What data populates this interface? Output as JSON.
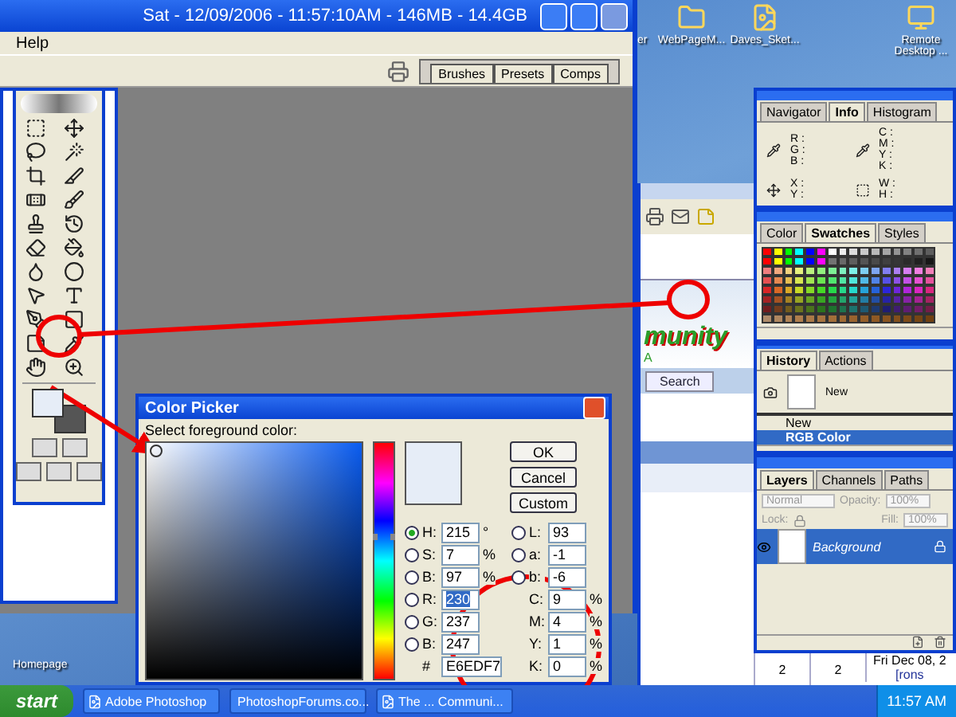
{
  "desktop": {
    "icons": [
      {
        "label": "WebPageM..."
      },
      {
        "label": "Daves_Sket..."
      },
      {
        "label": "Remote Desktop ..."
      }
    ],
    "partial_label": "er",
    "bottom_label": "Homepage"
  },
  "photoshop": {
    "title": "Sat - 12/09/2006 - 11:57:10AM - 146MB - 14.4GB",
    "menu": [
      "Help"
    ],
    "palette_well_tabs": [
      "Brushes",
      "Presets",
      "Comps"
    ]
  },
  "color_picker": {
    "title": "Color Picker",
    "prompt": "Select foreground color:",
    "buttons": [
      "OK",
      "Cancel",
      "Custom"
    ],
    "left_fields": [
      {
        "label": "H:",
        "value": "215",
        "unit": "°",
        "kind": "radio",
        "selected": true,
        "highlighted": false
      },
      {
        "label": "S:",
        "value": "7",
        "unit": "%",
        "kind": "radio",
        "selected": false,
        "highlighted": false
      },
      {
        "label": "B:",
        "value": "97",
        "unit": "%",
        "kind": "radio",
        "selected": false,
        "highlighted": false
      },
      {
        "label": "R:",
        "value": "230",
        "kind": "radio",
        "selected": false,
        "highlighted": true
      },
      {
        "label": "G:",
        "value": "237",
        "kind": "radio",
        "selected": false,
        "highlighted": false
      },
      {
        "label": "B:",
        "value": "247",
        "kind": "radio",
        "selected": false,
        "highlighted": false
      }
    ],
    "right_fields": [
      {
        "label": "L:",
        "value": "93",
        "kind": "radio",
        "selected": false
      },
      {
        "label": "a:",
        "value": "-1",
        "kind": "radio",
        "selected": false
      },
      {
        "label": "b:",
        "value": "-6",
        "kind": "radio",
        "selected": false
      },
      {
        "label": "C:",
        "value": "9",
        "unit": "%",
        "kind": "plain"
      },
      {
        "label": "M:",
        "value": "4",
        "unit": "%",
        "kind": "plain"
      },
      {
        "label": "Y:",
        "value": "1",
        "unit": "%",
        "kind": "plain"
      },
      {
        "label": "K:",
        "value": "0",
        "unit": "%",
        "kind": "plain"
      }
    ],
    "hue_slider": {
      "level": 0.6
    },
    "hex_label": "#",
    "hex_value": "E6EDF7"
  },
  "info_palette": {
    "tabs": [
      {
        "label": "Navigator",
        "selected": false
      },
      {
        "label": "Info",
        "selected": true
      },
      {
        "label": "Histogram",
        "selected": false
      }
    ],
    "readouts": [
      [
        "R :",
        "G :",
        "B :"
      ],
      [
        "C :",
        "M :",
        "Y :",
        "K :"
      ],
      [
        "X :",
        "Y :"
      ],
      [
        "W :",
        "H :"
      ]
    ]
  },
  "swatches_palette": {
    "tabs": [
      {
        "label": "Color",
        "selected": false
      },
      {
        "label": "Swatches",
        "selected": true
      },
      {
        "label": "Styles",
        "selected": false
      }
    ]
  },
  "history_palette": {
    "tabs": [
      {
        "label": "History",
        "selected": true
      },
      {
        "label": "Actions",
        "selected": false
      }
    ],
    "snapshot": "New",
    "states": [
      {
        "label": "New",
        "selected": false
      },
      {
        "label": "RGB Color",
        "selected": true
      }
    ]
  },
  "layers_palette": {
    "tabs": [
      {
        "label": "Layers",
        "selected": true
      },
      {
        "label": "Channels",
        "selected": false
      },
      {
        "label": "Paths",
        "selected": false
      }
    ],
    "blend_mode": "Normal",
    "opacity_label": "Opacity:",
    "opacity": "100%",
    "lock_label": "Lock:",
    "fill_label": "Fill:",
    "fill": "100%",
    "layers": [
      {
        "name": "Background",
        "selected": true
      }
    ]
  },
  "browser": {
    "logo_text": "munity",
    "logo_subtext": "A",
    "nav_buttons": [
      "Search"
    ],
    "cells": [
      "2",
      "2",
      "Fri Dec 08, 2",
      "[rons"
    ]
  },
  "taskbar": {
    "start": "start",
    "tasks": [
      {
        "label": "Adobe Photoshop"
      },
      {
        "label": "PhotoshopForums.co..."
      },
      {
        "label": "The ... Communi..."
      }
    ],
    "clock": "11:57 AM"
  }
}
